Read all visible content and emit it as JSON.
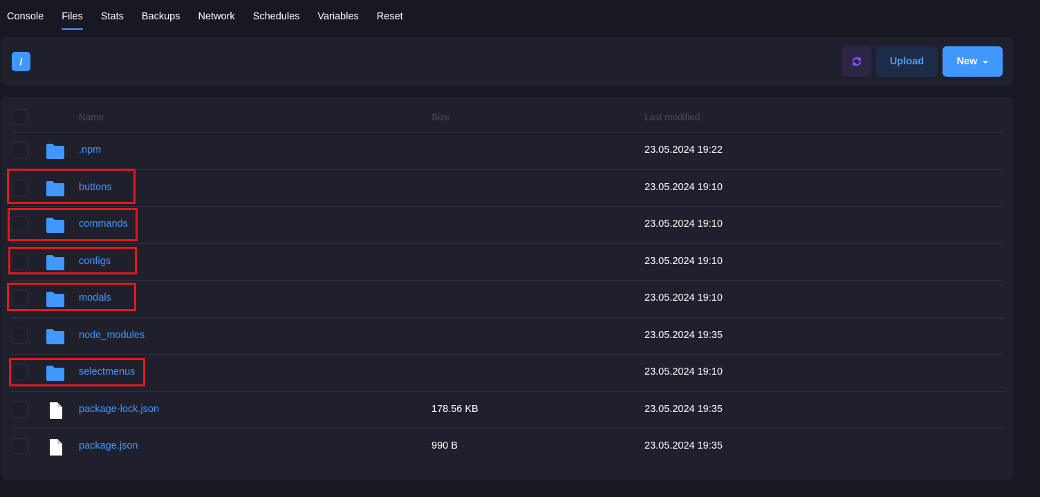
{
  "tabs": [
    {
      "label": "Console",
      "active": false
    },
    {
      "label": "Files",
      "active": true
    },
    {
      "label": "Stats",
      "active": false
    },
    {
      "label": "Backups",
      "active": false
    },
    {
      "label": "Network",
      "active": false
    },
    {
      "label": "Schedules",
      "active": false
    },
    {
      "label": "Variables",
      "active": false
    },
    {
      "label": "Reset",
      "active": false
    }
  ],
  "path": {
    "label": "/"
  },
  "toolbar": {
    "upload_label": "Upload",
    "new_label": "New"
  },
  "table": {
    "headers": {
      "name": "Name",
      "size": "Size",
      "modified": "Last modified"
    },
    "rows": [
      {
        "type": "folder",
        "name": ".npm",
        "size": "",
        "modified": "23.05.2024 19:22"
      },
      {
        "type": "folder",
        "name": "buttons",
        "size": "",
        "modified": "23.05.2024 19:10"
      },
      {
        "type": "folder",
        "name": "commands",
        "size": "",
        "modified": "23.05.2024 19:10"
      },
      {
        "type": "folder",
        "name": "configs",
        "size": "",
        "modified": "23.05.2024 19:10"
      },
      {
        "type": "folder",
        "name": "modals",
        "size": "",
        "modified": "23.05.2024 19:10"
      },
      {
        "type": "folder",
        "name": "node_modules",
        "size": "",
        "modified": "23.05.2024 19:35"
      },
      {
        "type": "folder",
        "name": "selectmenus",
        "size": "",
        "modified": "23.05.2024 19:10"
      },
      {
        "type": "file",
        "name": "package-lock.json",
        "size": "178.56 KB",
        "modified": "23.05.2024 19:35"
      },
      {
        "type": "file",
        "name": "package.json",
        "size": "990 B",
        "modified": "23.05.2024 19:35"
      }
    ]
  },
  "colors": {
    "accent": "#3f97ff",
    "background": "#181822",
    "panel": "#20202d",
    "highlight": "#e01a1a"
  },
  "icons": {
    "folder": "folder-icon",
    "file": "file-icon",
    "refresh": "refresh-icon",
    "dropdown": "caret-down-icon"
  }
}
